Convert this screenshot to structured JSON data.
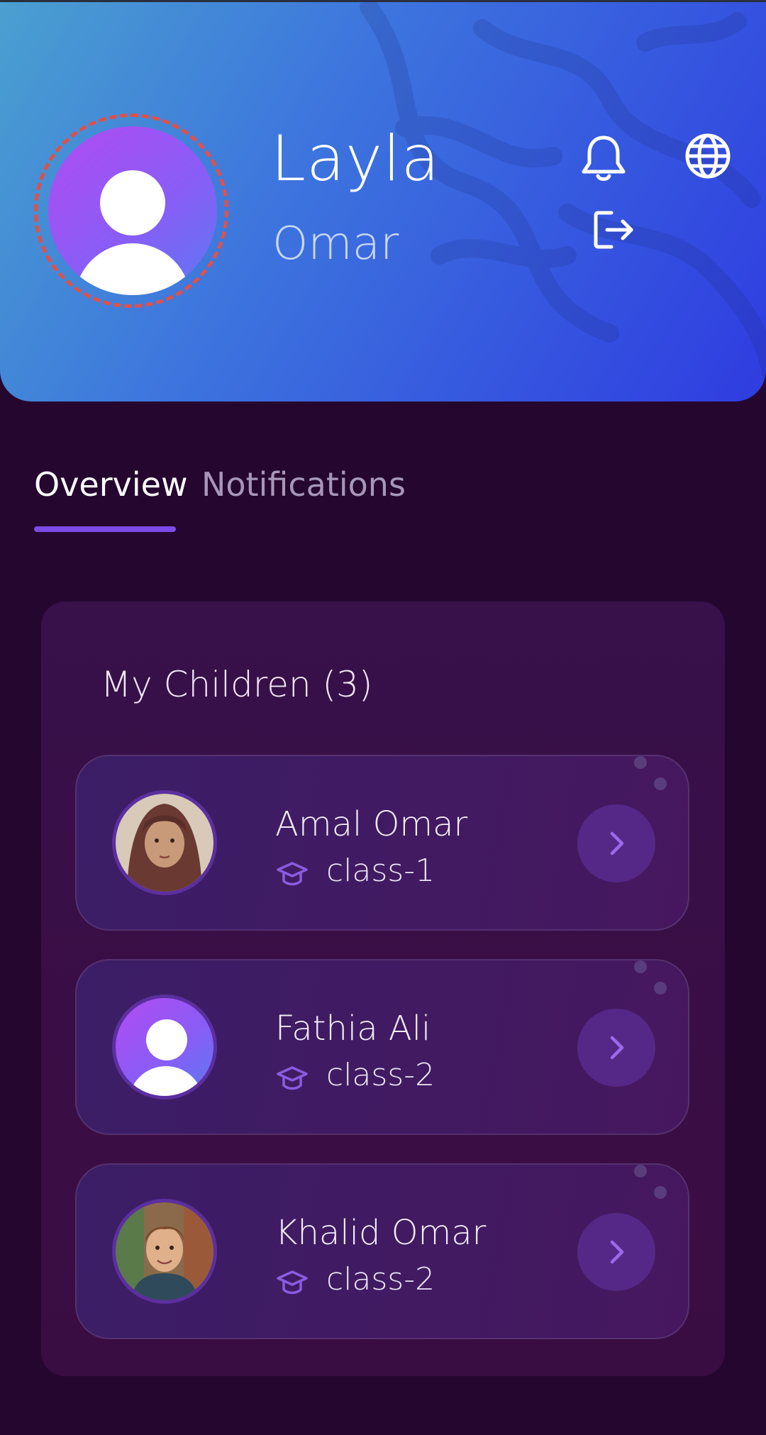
{
  "profile": {
    "first_name": "Layla",
    "last_name": "Omar"
  },
  "header_icons": [
    "bell-icon",
    "globe-icon",
    "logout-icon"
  ],
  "tabs": [
    {
      "label": "Overview",
      "active": true
    },
    {
      "label": "Notifications",
      "active": false
    }
  ],
  "children_section": {
    "title": "My Children (3)",
    "items": [
      {
        "name": "Amal Omar",
        "class": "class-1",
        "avatar": "photo"
      },
      {
        "name": "Fathia Ali",
        "class": "class-2",
        "avatar": "default-avatar"
      },
      {
        "name": "Khalid Omar",
        "class": "class-2",
        "avatar": "photo"
      }
    ]
  },
  "colors": {
    "background": "#25062f",
    "header_gradient_start": "#4aa0d0",
    "header_gradient_end": "#2f3ce0",
    "accent": "#7c4ae6",
    "avatar_ring": "#e0504a"
  }
}
